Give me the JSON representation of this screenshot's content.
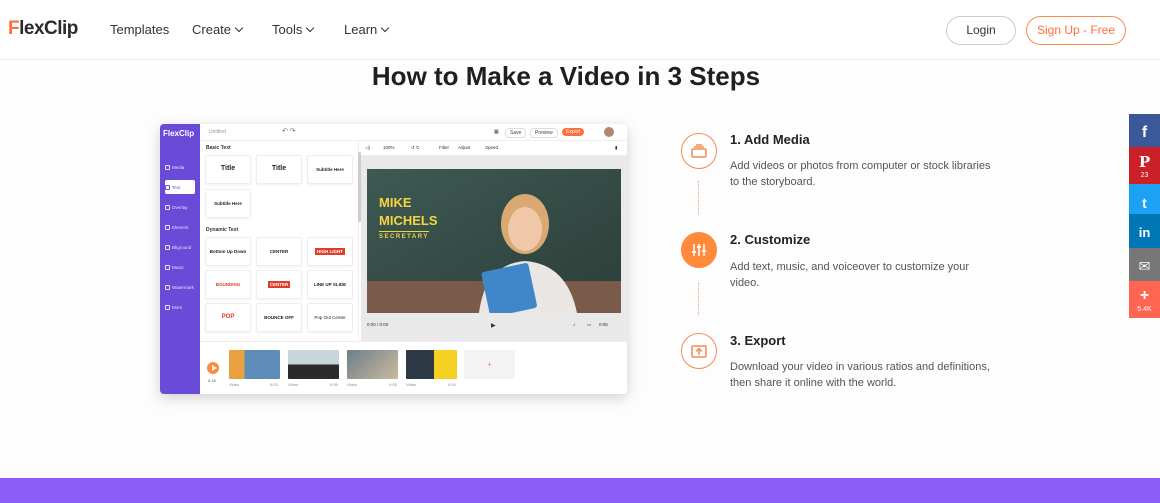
{
  "nav": {
    "logo_f": "F",
    "logo_rest": "lexClip",
    "items": [
      {
        "label": "Templates",
        "dropdown": false
      },
      {
        "label": "Create",
        "dropdown": true
      },
      {
        "label": "Tools",
        "dropdown": true
      },
      {
        "label": "Learn",
        "dropdown": true
      }
    ],
    "login": "Login",
    "signup": "Sign Up - Free"
  },
  "main": {
    "heading": "How to Make a Video in 3 Steps"
  },
  "editor": {
    "logo": "FlexClip",
    "untitled": "Untitled",
    "toolbar": {
      "save": "Save",
      "preview": "Preview",
      "export": "Export"
    },
    "sidebar": [
      "Media",
      "Text",
      "Overlay",
      "Element",
      "Bkground",
      "Music",
      "Watermark",
      "More"
    ],
    "basic_text_label": "Basic Text",
    "dynamic_text_label": "Dynamic Text",
    "basic_cards": [
      "Title",
      "Title",
      "Subtitle Here",
      "Subtitle Here"
    ],
    "dynamic_cards": [
      "Bottom Up Down",
      "CENTER",
      "HIGH LIGHT",
      "BOUNDING",
      "CENTER",
      "LINE UP SLIDE",
      "POP",
      "BOUNCE OFF",
      "Pop Out Center"
    ],
    "player_toolbar": {
      "zoom": "100%",
      "filter": "Filter",
      "adjust": "Adjust",
      "speed": "Speed"
    },
    "overlay_name": "MIKE MICHELS",
    "overlay_role": "SECRETARY",
    "time_left": "0:00 / 0:00",
    "time_right": "0:05",
    "timeline_time": "0:18",
    "clips": [
      {
        "label": "Video",
        "dur": "0:03"
      },
      {
        "label": "Video",
        "dur": "0:05"
      },
      {
        "label": "Video",
        "dur": "0:05"
      },
      {
        "label": "Video",
        "dur": "0:04"
      }
    ],
    "add_clip": "+"
  },
  "steps": [
    {
      "title": "1. Add Media",
      "desc": "Add videos or photos from computer or stock libraries to the storyboard.",
      "icon": "media-icon"
    },
    {
      "title": "2. Customize",
      "desc": "Add text, music, and voiceover to customize your video.",
      "icon": "sliders-icon"
    },
    {
      "title": "3. Export",
      "desc": "Download your video in various ratios and definitions, then share it online with the world.",
      "icon": "export-icon"
    }
  ],
  "share": [
    {
      "name": "facebook",
      "glyph": "f",
      "count": "",
      "color": "#3b5998"
    },
    {
      "name": "pinterest",
      "glyph": "P",
      "count": "23",
      "color": "#cb2027"
    },
    {
      "name": "twitter",
      "glyph": "t",
      "count": "",
      "color": "#1da1f2"
    },
    {
      "name": "linkedin",
      "glyph": "in",
      "count": "",
      "color": "#0077b5"
    },
    {
      "name": "email",
      "glyph": "✉",
      "count": "",
      "color": "#777777"
    },
    {
      "name": "more",
      "glyph": "+",
      "count": "5.4K",
      "color": "#ff6550"
    }
  ],
  "colors": {
    "accent": "#ff6f3c",
    "editor_sidebar": "#6a4bd8",
    "band": "#8b5cf6"
  }
}
